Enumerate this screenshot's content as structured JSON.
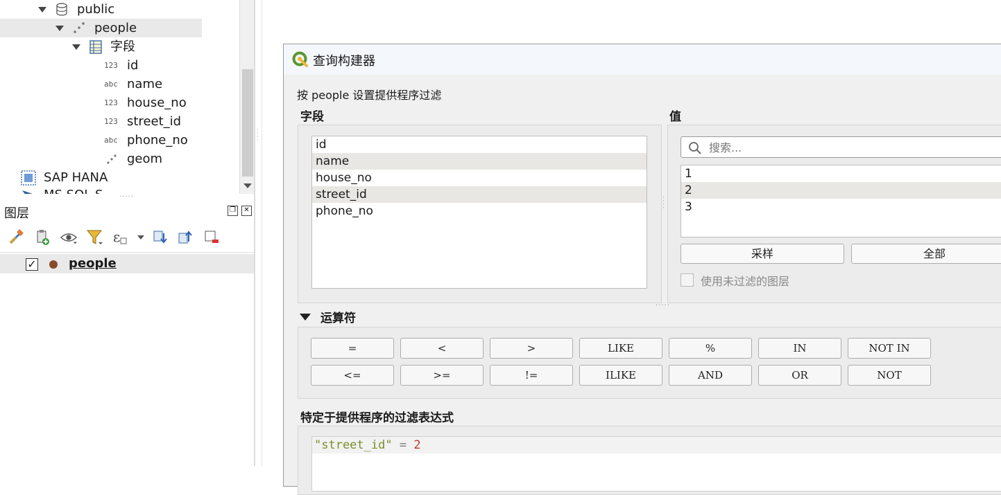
{
  "browser": {
    "items": [
      {
        "label": "public",
        "type": "schema"
      },
      {
        "label": "people",
        "type": "layer"
      },
      {
        "label": "字段",
        "type": "fields"
      },
      {
        "label": "id",
        "kind": "123"
      },
      {
        "label": "name",
        "kind": "abc"
      },
      {
        "label": "house_no",
        "kind": "123"
      },
      {
        "label": "street_id",
        "kind": "123"
      },
      {
        "label": "phone_no",
        "kind": "abc"
      },
      {
        "label": "geom",
        "kind": "geometry"
      },
      {
        "label": "SAP HANA",
        "type": "provider"
      },
      {
        "label": "MS SQL S",
        "type": "provider"
      }
    ]
  },
  "layers_panel": {
    "title": "图层",
    "layers": [
      {
        "name": "people",
        "checked": true,
        "color": "#8a4a2a"
      }
    ]
  },
  "dialog": {
    "title": "查询构建器",
    "subtitle": "按 people 设置提供程序过滤",
    "fields_label": "字段",
    "values_label": "值",
    "fields": [
      "id",
      "name",
      "house_no",
      "street_id",
      "phone_no"
    ],
    "search_placeholder": "搜索...",
    "values": [
      "1",
      "2",
      "3"
    ],
    "sample_button": "采样",
    "all_button": "全部",
    "use_unfiltered_label": "使用未过滤的图层",
    "operators_label": "运算符",
    "operators_row1": [
      "=",
      "<",
      ">",
      "LIKE",
      "%",
      "IN",
      "NOT IN"
    ],
    "operators_row2": [
      "<=",
      ">=",
      "!=",
      "ILIKE",
      "AND",
      "OR",
      "NOT"
    ],
    "expression_label": "特定于提供程序的过滤表达式",
    "expression": {
      "field": "\"street_id\"",
      "op": "=",
      "value": "2"
    }
  },
  "colors": {
    "accent_green": "#589632",
    "selected_row": "#e8e7e4"
  }
}
